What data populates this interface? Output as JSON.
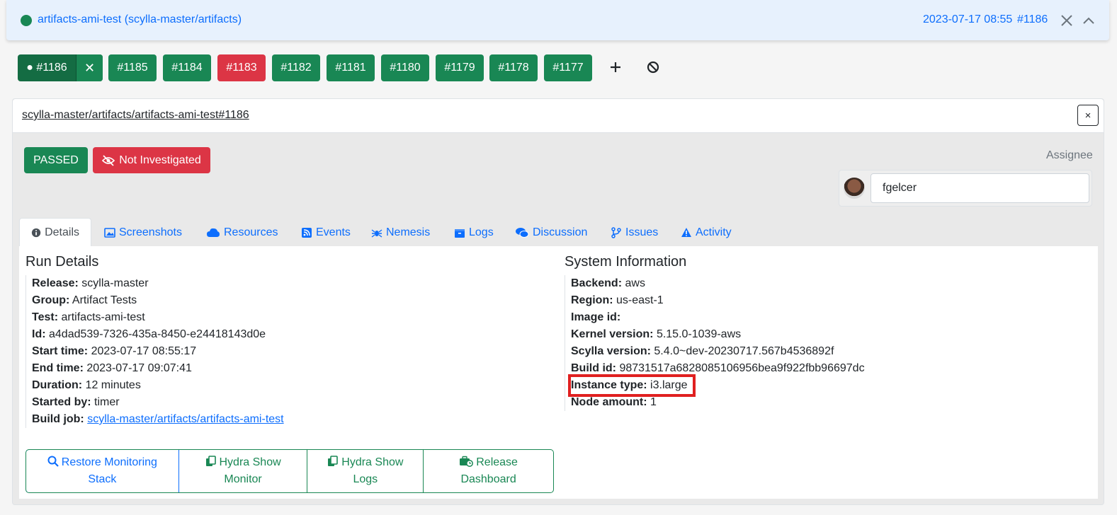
{
  "header": {
    "title": "artifacts-ami-test (scylla-master/artifacts)",
    "date": "2023-07-17 08:55",
    "run": "#1186",
    "status_color": "#198754"
  },
  "runs": {
    "active": {
      "label": "● #1186",
      "close": "✕"
    },
    "items": [
      "#1185",
      "#1184",
      "#1183",
      "#1182",
      "#1181",
      "#1180",
      "#1179",
      "#1178",
      "#1177"
    ],
    "failed_run": "#1183"
  },
  "panel": {
    "path": "scylla-master/artifacts/artifacts-ami-test#1186",
    "close": "×",
    "status_badge": "PASSED",
    "investigation_badge": "Not Investigated",
    "assignee_label": "Assignee",
    "assignee_value": "fgelcer"
  },
  "tabs": [
    {
      "label": "Details",
      "icon": "info-icon"
    },
    {
      "label": "Screenshots",
      "icon": "image-icon"
    },
    {
      "label": "Resources",
      "icon": "cloud-icon"
    },
    {
      "label": "Events",
      "icon": "rss-icon"
    },
    {
      "label": "Nemesis",
      "icon": "spider-icon"
    },
    {
      "label": "Logs",
      "icon": "box-icon"
    },
    {
      "label": "Discussion",
      "icon": "comments-icon"
    },
    {
      "label": "Issues",
      "icon": "branch-icon"
    },
    {
      "label": "Activity",
      "icon": "warning-icon"
    }
  ],
  "run_details": {
    "title": "Run Details",
    "rows": [
      {
        "key": "Release:",
        "value": "scylla-master"
      },
      {
        "key": "Group:",
        "value": "Artifact Tests"
      },
      {
        "key": "Test:",
        "value": "artifacts-ami-test"
      },
      {
        "key": "Id:",
        "value": "a4dad539-7326-435a-8450-e24418143d0e"
      },
      {
        "key": "Start time:",
        "value": "2023-07-17 08:55:17"
      },
      {
        "key": "End time:",
        "value": "2023-07-17 09:07:41"
      },
      {
        "key": "Duration:",
        "value": "12 minutes"
      },
      {
        "key": "Started by:",
        "value": "timer"
      },
      {
        "key": "Build job:",
        "value": "scylla-master/artifacts/artifacts-ami-test"
      }
    ]
  },
  "system_info": {
    "title": "System Information",
    "rows": [
      {
        "key": "Backend:",
        "value": "aws"
      },
      {
        "key": "Region:",
        "value": "us-east-1"
      },
      {
        "key": "Image id:",
        "value": ""
      },
      {
        "key": "Kernel version:",
        "value": "5.15.0-1039-aws"
      },
      {
        "key": "Scylla version:",
        "value": "5.4.0~dev-20230717.567b4536892f"
      },
      {
        "key": "Build id:",
        "value": "98731517a6828085106956bea9f922fbb96697dc"
      },
      {
        "key": "Instance type:",
        "value": "i3.large"
      },
      {
        "key": "Node amount:",
        "value": "1"
      }
    ]
  },
  "actions": {
    "restore": [
      "Restore Monitoring",
      "Stack"
    ],
    "hydra_monitor": [
      "Hydra Show",
      "Monitor"
    ],
    "hydra_logs": [
      "Hydra Show",
      "Logs"
    ],
    "release_dashboard": [
      "Release",
      "Dashboard"
    ]
  },
  "colors": {
    "success": "#198754",
    "danger": "#dc3545",
    "primary": "#0d6efd",
    "highlight": "#e02020"
  }
}
